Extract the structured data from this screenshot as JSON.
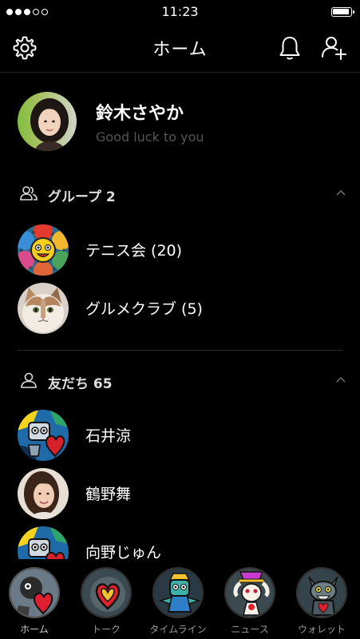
{
  "status_bar": {
    "time": "11:23"
  },
  "header": {
    "title": "ホーム"
  },
  "profile": {
    "name": "鈴木さやか",
    "status": "Good luck to you"
  },
  "groups": {
    "title": "グループ 2",
    "items": [
      {
        "name": "テニス会 (20)",
        "icon": "flower-avatar"
      },
      {
        "name": "グルメクラブ (5)",
        "icon": "cat-avatar"
      }
    ]
  },
  "friends": {
    "title": "友だち 65",
    "items": [
      {
        "name": "石井涼",
        "icon": "robot-heart-avatar"
      },
      {
        "name": "鶴野舞",
        "icon": "woman-photo-avatar"
      },
      {
        "name": "向野じゅん",
        "icon": "robot-heart-avatar"
      }
    ]
  },
  "tabs": [
    {
      "label": "ホーム",
      "icon": "home-tab-avatar",
      "active": true
    },
    {
      "label": "トーク",
      "icon": "heart-tab-avatar",
      "active": false
    },
    {
      "label": "タイムライン",
      "icon": "character-tab-avatar",
      "active": false
    },
    {
      "label": "ニュース",
      "icon": "rabbit-tab-avatar",
      "active": false
    },
    {
      "label": "ウォレット",
      "icon": "monster-tab-avatar",
      "active": false
    }
  ]
}
